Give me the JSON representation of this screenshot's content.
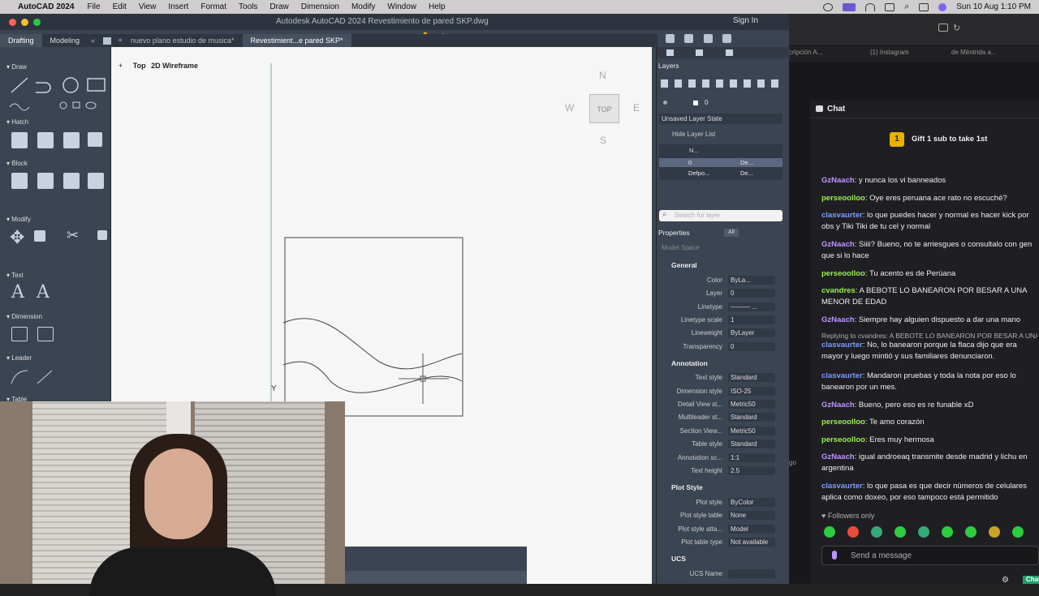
{
  "menubar": {
    "app": "AutoCAD 2024",
    "items": [
      "File",
      "Edit",
      "View",
      "Insert",
      "Format",
      "Tools",
      "Draw",
      "Dimension",
      "Modify",
      "Window",
      "Help"
    ],
    "clock": "Sun 10 Aug  1:10 PM"
  },
  "acad": {
    "title": "Autodesk AutoCAD 2024   Revestimiento de pared  SKP.dwg",
    "signin": "Sign In",
    "workspace_tabs": [
      "Drafting",
      "Modeling"
    ],
    "doc_tabs": [
      "nuevo plano estudio de musica*",
      "Revestimient...e pared  SKP*"
    ],
    "viewport": {
      "view": "Top",
      "style": "2D Wireframe"
    },
    "viewcube": {
      "n": "N",
      "s": "S",
      "e": "E",
      "w": "W",
      "face": "TOP"
    },
    "ucs_y": "Y",
    "palette_sections": [
      "Draw",
      "Hatch",
      "Block",
      "Modify",
      "Text",
      "Dimension",
      "Leader",
      "Table"
    ]
  },
  "layers": {
    "title": "Layers",
    "current": "0",
    "state": "Unsaved Layer State",
    "hide_list": "Hide Layer List",
    "col_name": "N...",
    "rows": [
      {
        "name": "0",
        "ltype": "De..."
      },
      {
        "name": "Defpo...",
        "ltype": "De..."
      }
    ],
    "search_placeholder": "Search for layer"
  },
  "properties": {
    "title": "Properties",
    "filter_all": "All",
    "space": "Model Space",
    "general": "General",
    "annotation": "Annotation",
    "plotstyle": "Plot Style",
    "ucs": "UCS",
    "rows": [
      {
        "label": "Color",
        "value": "ByLa..."
      },
      {
        "label": "Layer",
        "value": "0"
      },
      {
        "label": "Linetype",
        "value": "———  ..."
      },
      {
        "label": "Linetype scale",
        "value": "1"
      },
      {
        "label": "Lineweight",
        "value": "ByLayer"
      },
      {
        "label": "Transparency",
        "value": "0"
      },
      {
        "label": "Text style",
        "value": "Standard"
      },
      {
        "label": "Dimension style",
        "value": "ISO-25"
      },
      {
        "label": "Detail View st...",
        "value": "Metric50"
      },
      {
        "label": "Multileader st...",
        "value": "Standard"
      },
      {
        "label": "Section View...",
        "value": "Metric50"
      },
      {
        "label": "Table style",
        "value": "Standard"
      },
      {
        "label": "Annotation sc...",
        "value": "1:1"
      },
      {
        "label": "Text height",
        "value": "2.5"
      },
      {
        "label": "Plot style",
        "value": "ByColor"
      },
      {
        "label": "Plot style table",
        "value": "None"
      },
      {
        "label": "Plot style atta...",
        "value": "Model"
      },
      {
        "label": "Plot table type",
        "value": "Not available"
      },
      {
        "label": "UCS Name",
        "value": ""
      }
    ]
  },
  "browser": {
    "tabs": [
      "cripción A...",
      "(1) Instagram",
      "de Méntrida a..."
    ],
    "side_text": "go"
  },
  "chat": {
    "title": "Chat",
    "gift": "Gift 1 sub to take 1st",
    "followers": "Followers only",
    "input_placeholder": "Send a message",
    "send": "Chat",
    "messages": [
      {
        "user": "GzNaach",
        "color": "#bf94ff",
        "text": ": y nunca los vi banneados"
      },
      {
        "user": "perseoolloo",
        "color": "#9aee52",
        "text": ": Oye eres peruana ace rato no escuché?"
      },
      {
        "user": "clasvaurter",
        "color": "#7c9cff",
        "text": ": lo que puedes hacer y normal es hacer kick por obs y Tiki Tiki de tu cel y normal"
      },
      {
        "user": "GzNaach",
        "color": "#bf94ff",
        "text": ": Siiii? Bueno, no te arriesgues o consultalo con gen que si lo hace"
      },
      {
        "user": "perseoolloo",
        "color": "#9aee52",
        "text": ": Tu acento es de Perúana"
      },
      {
        "user": "cvandres",
        "color": "#9aee52",
        "text": ": A BEBOTE LO BANEARON POR BESAR A UNA MENOR DE EDAD"
      },
      {
        "user": "GzNaach",
        "color": "#bf94ff",
        "text": ": Siempre hay alguien dispuesto a dar una mano"
      },
      {
        "user": "clasvaurter",
        "color": "#7c9cff",
        "text": ": No, lo banearon porque la flaca dijo que era mayor y luego mintió y sus familiares denunciaron.",
        "reply": "Replying to cvandres: A BEBOTE LO BANEARON POR BESAR A UNA"
      },
      {
        "user": "clasvaurter",
        "color": "#7c9cff",
        "text": ": Mandaron pruebas y toda la nota por eso lo banearon por un mes."
      },
      {
        "user": "GzNaach",
        "color": "#bf94ff",
        "text": ": Bueno, pero eso es re funable xD"
      },
      {
        "user": "perseoolloo",
        "color": "#9aee52",
        "text": ": Te amo corazón"
      },
      {
        "user": "perseoolloo",
        "color": "#9aee52",
        "text": ": Eres muy hermosa"
      },
      {
        "user": "GzNaach",
        "color": "#bf94ff",
        "text": ": igual androeaq transmite desde madrid y lichu en argentina"
      },
      {
        "user": "clasvaurter",
        "color": "#7c9cff",
        "text": ": lo que pasa es que decir números de celulares aplica como doxeo, por eso tampoco está permitido"
      }
    ]
  }
}
